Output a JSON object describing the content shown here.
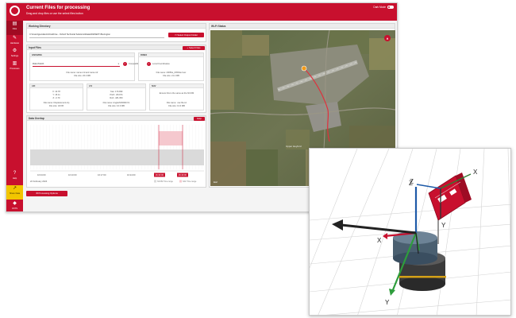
{
  "header": {
    "title": "Current Files for processing",
    "subtitle": "Drag and drop files or use the select files button",
    "mode_label": "Dark Mode"
  },
  "sidebar": {
    "items": [
      {
        "label": "Files",
        "icon": "file-icon"
      },
      {
        "label": "Hardware",
        "icon": "wrench-icon"
      },
      {
        "label": "Settings",
        "icon": "gear-icon"
      },
      {
        "label": "Processes",
        "icon": "list-icon"
      },
      {
        "label": "Help",
        "icon": "help-icon"
      },
      {
        "label": "Share Data",
        "icon": "share-icon"
      },
      {
        "label": "OXTS",
        "icon": "brand-icon"
      }
    ]
  },
  "working_directory": {
    "title": "Working Directory",
    "path": "C:\\Users\\jpendarvis\\OneDrive - Oxford Technical Solutions\\Data\\2020\\EXT-Brerington",
    "button": "Select Output Folder"
  },
  "input_files": {
    "title": "Input Files",
    "button": "Select Files",
    "gnss_ins": {
      "title": "GNSS/INS",
      "select_value": "RoboTrACK",
      "compat": "Compatible",
      "info1": "File name: name.rnd and name.rdr",
      "info2": "File size: 26.3 MB"
    },
    "rinex": {
      "title": "RINEX",
      "compat": "Local Coordinates",
      "info1": "File name: 20050e_RXR3a.rinex",
      "info2": "File size: 21.2 MB"
    },
    "lid": {
      "title": "LID",
      "x": "X: 10.78",
      "y": "Y: 15.11",
      "z": "Z: -0.79",
      "info1": "File name: Displacement.lcp",
      "info2": "File size: 32 KB"
    },
    "liv": {
      "title": "LIV",
      "yaw": "Yaw: 179.999",
      "pitch": "Pitch: -89.974",
      "roll": "Roll: -181.050",
      "info1": "File name: Angles5160fd0.fr1",
      "info2": "File size: 10.3 MB"
    },
    "nav": {
      "title": "NAV",
      "msg": "Ensure this is the same as the NCOM",
      "info1": "File name: .nav file.txt",
      "info2": "File size: 13.3 MB"
    }
  },
  "data_overlap": {
    "title": "Data Overlap",
    "button": "Help",
    "ticks": [
      "16:04:00",
      "16:10:00",
      "16:17:00",
      "16:24:00",
      "16:30:00",
      "16:40:00"
    ],
    "date": "22 February 2024",
    "legend": [
      "NCOM Time range",
      "NAV Time range"
    ]
  },
  "map": {
    "title": "Wi-Fi Status",
    "place": "Upper Heyford",
    "credit": "Esri"
  },
  "buttons": {
    "processing_options": "Processing Options",
    "view_config": "View Hardware Configuration",
    "boresight": "Run Boresight Calibration",
    "georef": "Run Georeferencing"
  },
  "inset": {
    "axes": [
      "X",
      "Y",
      "Z",
      "X",
      "Y",
      "Z"
    ],
    "device_label": "OXTS"
  }
}
